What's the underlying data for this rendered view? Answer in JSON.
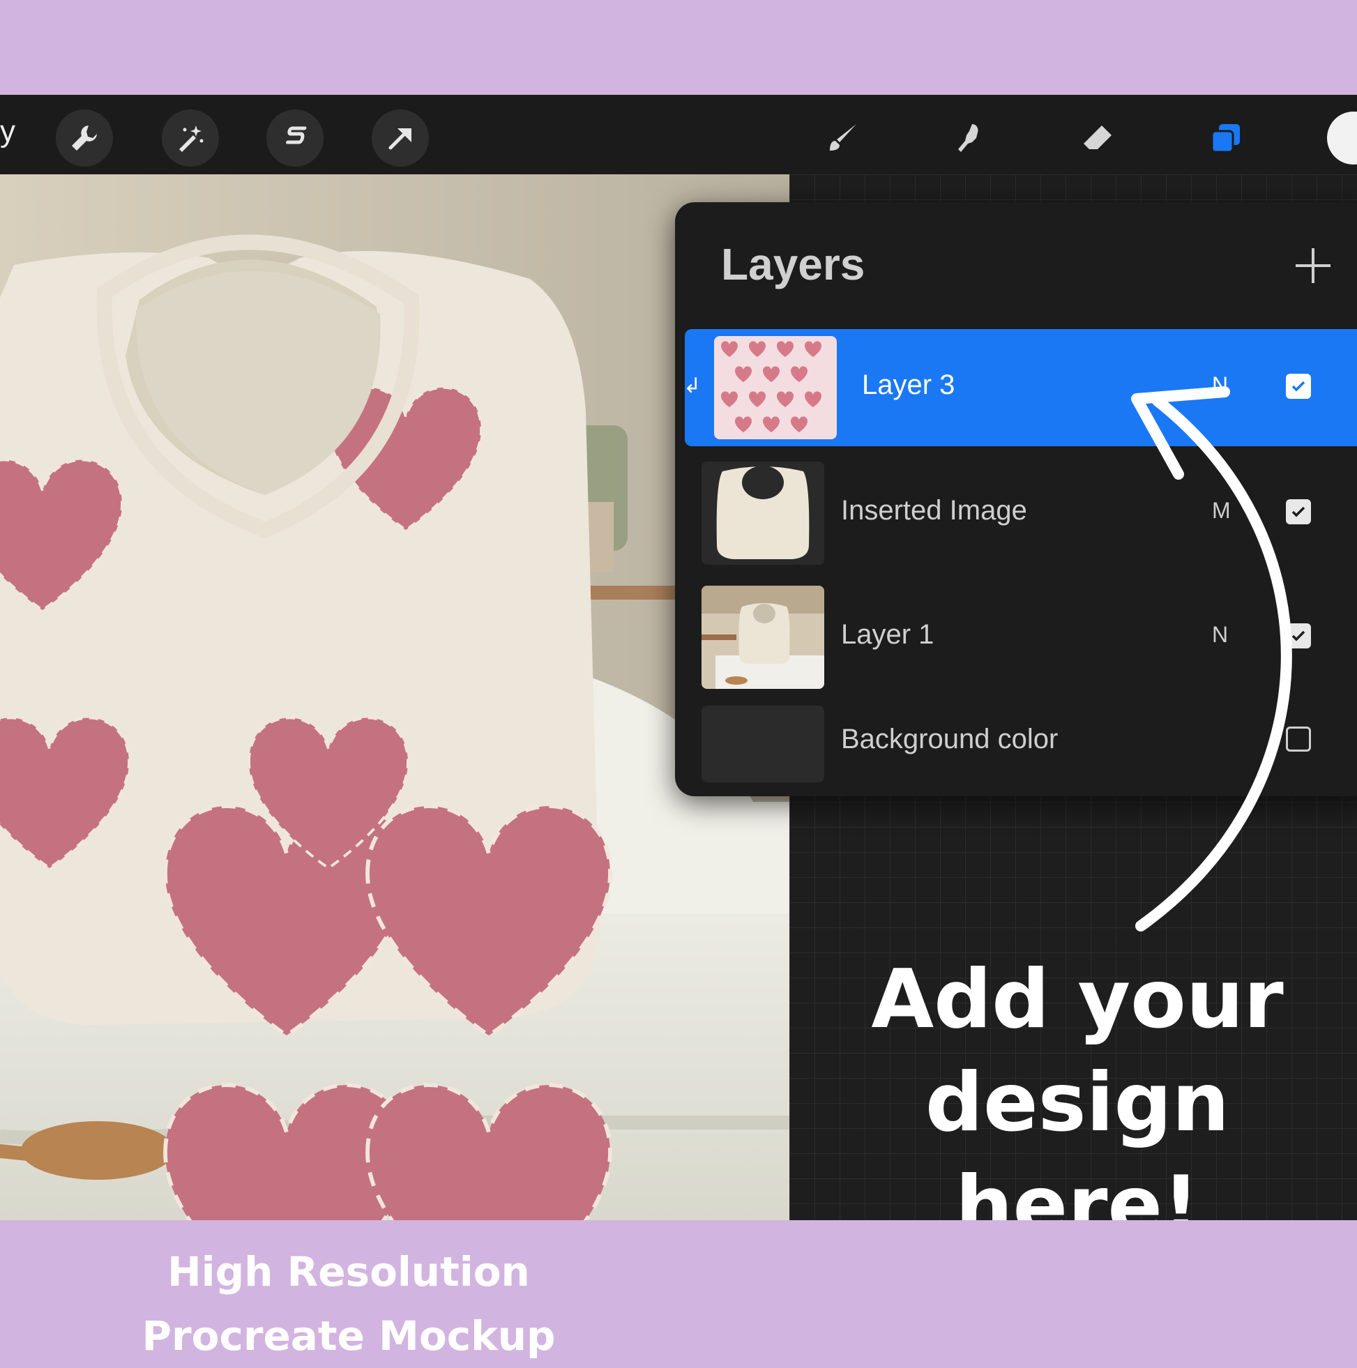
{
  "toolbar": {
    "gallery_fragment": "y",
    "left_tools": [
      {
        "icon": "wrench-icon",
        "label": "Actions"
      },
      {
        "icon": "magic-wand-icon",
        "label": "Adjustments"
      },
      {
        "icon": "selection-icon",
        "label": "Selection"
      },
      {
        "icon": "transform-arrow-icon",
        "label": "Transform"
      }
    ],
    "right_tools": [
      {
        "icon": "brush-icon"
      },
      {
        "icon": "smudge-icon"
      },
      {
        "icon": "eraser-icon"
      },
      {
        "icon": "layers-icon"
      }
    ],
    "active_tool_color": "#1a78f5",
    "current_color": "#f2f2f2"
  },
  "layers": {
    "title": "Layers",
    "add_icon": "plus-icon",
    "items": [
      {
        "name": "Layer 3",
        "mode": "N",
        "visible": true,
        "selected": true,
        "thumb": "heart-pattern"
      },
      {
        "name": "Inserted Image",
        "mode": "M",
        "visible": true,
        "selected": false,
        "thumb": "blank-bib"
      },
      {
        "name": "Layer 1",
        "mode": "N",
        "visible": true,
        "selected": false,
        "thumb": "bib-on-highchair"
      },
      {
        "name": "Background color",
        "mode": "",
        "visible": false,
        "selected": false,
        "thumb": "dark-swatch"
      }
    ]
  },
  "callout": {
    "line1": "Add your",
    "line2": "design here!"
  },
  "footer": {
    "line1": "High Resolution",
    "line2": "Procreate Mockup"
  },
  "colors": {
    "band": "#d2b4e0",
    "heart": "#c4727f",
    "bib": "#ede6da"
  }
}
